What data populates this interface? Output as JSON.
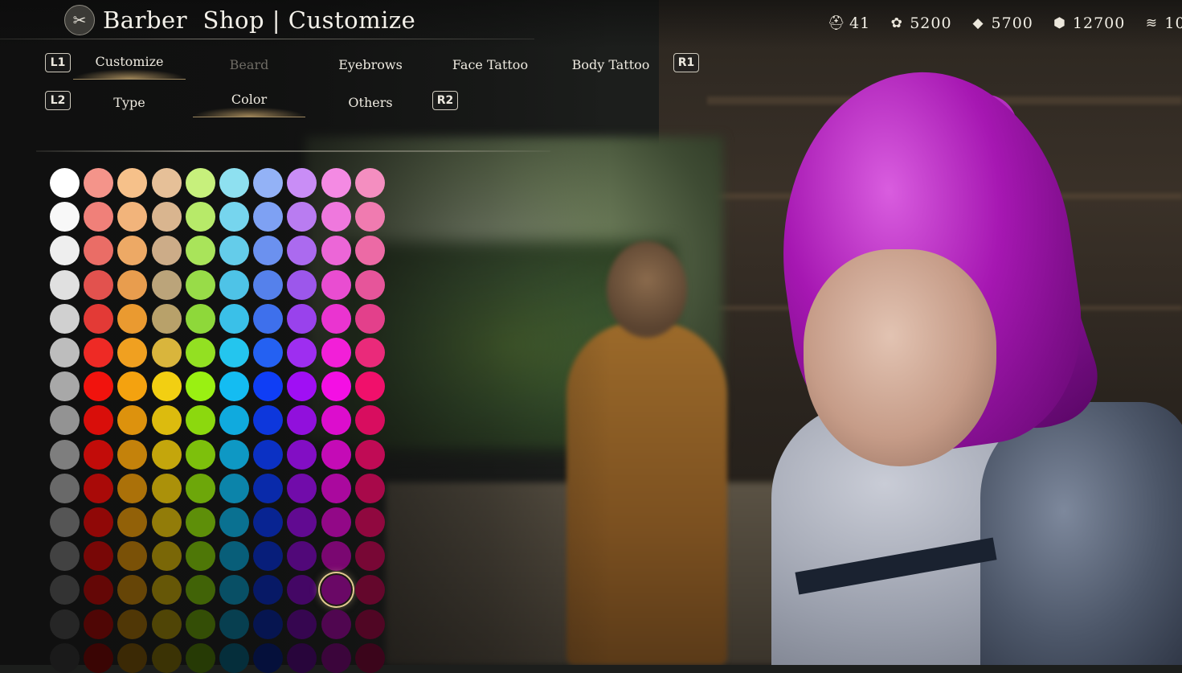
{
  "header": {
    "title": "Barber  Shop | Customize",
    "icon": "scissors-comb-icon"
  },
  "currency": [
    {
      "icon": "helmet-icon",
      "glyph": "⛑",
      "value": "41"
    },
    {
      "icon": "flower-material-icon",
      "glyph": "✿",
      "value": "5200"
    },
    {
      "icon": "crystal-material-icon",
      "glyph": "◆",
      "value": "5700"
    },
    {
      "icon": "ore-material-icon",
      "glyph": "⬢",
      "value": "12700"
    },
    {
      "icon": "cake-material-icon",
      "glyph": "≋",
      "value": "10"
    }
  ],
  "tabs_top": {
    "left_badge": "L1",
    "right_badge": "R1",
    "items": [
      {
        "label": "Customize",
        "state": "active"
      },
      {
        "label": "Beard",
        "state": "disabled"
      },
      {
        "label": "Eyebrows",
        "state": "normal"
      },
      {
        "label": "Face  Tattoo",
        "state": "normal"
      },
      {
        "label": "Body  Tattoo",
        "state": "normal"
      }
    ]
  },
  "tabs_sub": {
    "left_badge": "L2",
    "right_badge": "R2",
    "items": [
      {
        "label": "Type",
        "state": "normal"
      },
      {
        "label": "Color",
        "state": "active"
      },
      {
        "label": "Others",
        "state": "normal"
      }
    ]
  },
  "color_grid": {
    "selected": {
      "row": 12,
      "col": 8
    },
    "rows": [
      [
        "#ffffff",
        "#f4948a",
        "#f6c18a",
        "#e6c098",
        "#c7f07c",
        "#8ee0f0",
        "#93b2f6",
        "#c98df6",
        "#f48ae3",
        "#f48ec0"
      ],
      [
        "#f8f8f8",
        "#f08079",
        "#f2b47b",
        "#d9b58f",
        "#b7ea69",
        "#76d5ee",
        "#7ea1f3",
        "#b97cf1",
        "#ef78dd",
        "#f07bb0"
      ],
      [
        "#eeeeee",
        "#ea6d66",
        "#eda965",
        "#ccac88",
        "#a9e45a",
        "#64ccea",
        "#6b91ef",
        "#ab6aef",
        "#ec66d7",
        "#ec6aa5"
      ],
      [
        "#e0e0e0",
        "#e2524e",
        "#e89d4e",
        "#bba47a",
        "#98dc48",
        "#4ec3e7",
        "#5581eb",
        "#9c57eb",
        "#e94dd1",
        "#e6559a"
      ],
      [
        "#d0d0d0",
        "#e33a36",
        "#ea9a30",
        "#b8a16a",
        "#8ed83a",
        "#3ac0e8",
        "#3e70ec",
        "#9942ec",
        "#ea34d0",
        "#e3408b"
      ],
      [
        "#bdbdbd",
        "#ee2a25",
        "#f0a020",
        "#d9b53c",
        "#93e022",
        "#24c5ee",
        "#2461f2",
        "#9e2ef0",
        "#f21fd8",
        "#ea2a7a"
      ],
      [
        "#a8a8a8",
        "#f1130d",
        "#f4a20f",
        "#f2cf12",
        "#9af012",
        "#14bcf2",
        "#0f3ef5",
        "#a00ff4",
        "#f40fe4",
        "#f0106b"
      ],
      [
        "#939393",
        "#d90e0a",
        "#dd920d",
        "#dcbb0e",
        "#8cd80e",
        "#10aade",
        "#0d37dc",
        "#9110dc",
        "#dc0dcd",
        "#d80d5f"
      ],
      [
        "#7e7e7e",
        "#c20c09",
        "#c4820b",
        "#c4a60c",
        "#7dc00c",
        "#0e98c4",
        "#0b31c4",
        "#820ec4",
        "#c40bb6",
        "#c00b55"
      ],
      [
        "#696969",
        "#a90a08",
        "#ab7109",
        "#ab910a",
        "#6da70a",
        "#0c84aa",
        "#092aaa",
        "#710caa",
        "#aa099e",
        "#a8094a"
      ],
      [
        "#555555",
        "#900807",
        "#926108",
        "#927c09",
        "#5e8f09",
        "#0a7191",
        "#082492",
        "#610a91",
        "#920887",
        "#90083f"
      ],
      [
        "#424242",
        "#780706",
        "#7a5107",
        "#7a6707",
        "#4e7707",
        "#085e79",
        "#071e7a",
        "#510879",
        "#7a0771",
        "#780735"
      ],
      [
        "#333333",
        "#640706",
        "#664507",
        "#665707",
        "#416307",
        "#084f65",
        "#071966",
        "#440765",
        "#6a0866",
        "#64072c"
      ],
      [
        "#262626",
        "#4f0605",
        "#503706",
        "#504506",
        "#344e06",
        "#073f50",
        "#061550",
        "#360650",
        "#500650",
        "#500624"
      ],
      [
        "#1a1a1a",
        "#3a0504",
        "#3b2905",
        "#3b3305",
        "#263a05",
        "#052e3b",
        "#05103b",
        "#28053b",
        "#3b053b",
        "#3b051b"
      ]
    ]
  }
}
